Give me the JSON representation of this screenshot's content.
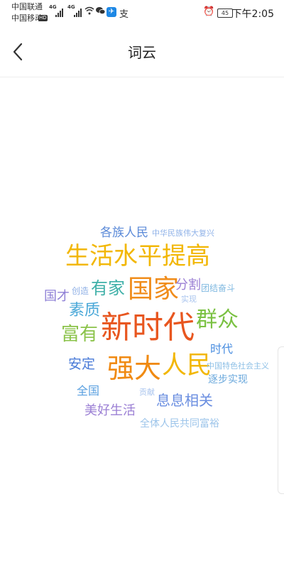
{
  "status": {
    "carrier1": "中国联通",
    "carrier2": "中国移动",
    "net1": "4G",
    "net2": "4G",
    "hd": "HD",
    "battery": "45",
    "time": "下午2:05"
  },
  "header": {
    "title": "词云"
  },
  "colors": {
    "accent": "#4a7bd8"
  },
  "cloud": {
    "words": [
      {
        "text": "各族人民",
        "color": "#5b8ad8"
      },
      {
        "text": "中华民族伟大复兴",
        "color": "#8fb2e8"
      },
      {
        "text": "生活水平提高",
        "color": "#f2b705"
      },
      {
        "text": "有家",
        "color": "#3fb0a8"
      },
      {
        "text": "国家",
        "color": "#f08c1a"
      },
      {
        "text": "分割",
        "color": "#9b7fd4"
      },
      {
        "text": "团结奋斗",
        "color": "#7fb8e0"
      },
      {
        "text": "国才",
        "color": "#8e7fd6"
      },
      {
        "text": "创造",
        "color": "#8fb0e6"
      },
      {
        "text": "实现",
        "color": "#a9c4ee"
      },
      {
        "text": "素质",
        "color": "#4aa8d8"
      },
      {
        "text": "新时代",
        "color": "#e8561f"
      },
      {
        "text": "群众",
        "color": "#7ac142"
      },
      {
        "text": "富有",
        "color": "#8bc34a"
      },
      {
        "text": "时代",
        "color": "#4a8ee0"
      },
      {
        "text": "安定",
        "color": "#4a7bd8"
      },
      {
        "text": "强大",
        "color": "#f08a12"
      },
      {
        "text": "人民",
        "color": "#f2b705"
      },
      {
        "text": "中国特色社会主义",
        "color": "#8ec0e6"
      },
      {
        "text": "逐步实现",
        "color": "#6aa8dc"
      },
      {
        "text": "全国",
        "color": "#5aa0e0"
      },
      {
        "text": "贡献",
        "color": "#a9c4ee"
      },
      {
        "text": "息息相关",
        "color": "#6a8ee0"
      },
      {
        "text": "美好生活",
        "color": "#9b7fd4"
      },
      {
        "text": "全体人民共同富裕",
        "color": "#9cc4ea"
      }
    ]
  }
}
